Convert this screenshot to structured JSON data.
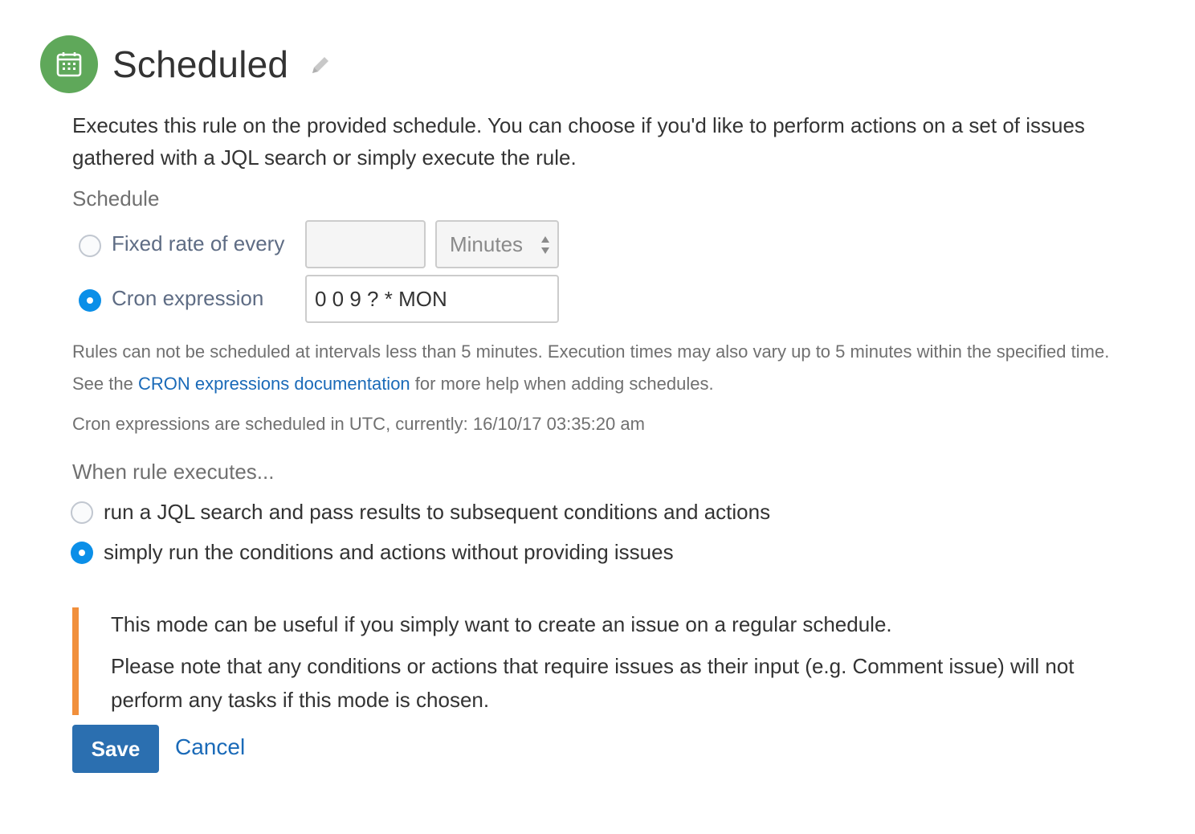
{
  "header": {
    "title": "Scheduled",
    "icon": "calendar-icon",
    "edit_icon": "pencil-icon",
    "accent_color": "#5fa85a"
  },
  "description": "Executes this rule on the provided schedule. You can choose if you'd like to perform actions on a set of issues gathered with a JQL search or simply execute the rule.",
  "schedule": {
    "label": "Schedule",
    "fixed_rate": {
      "label": "Fixed rate of every",
      "checked": false,
      "value": "",
      "unit": "Minutes"
    },
    "cron": {
      "label": "Cron expression",
      "checked": true,
      "value": "0 0 9 ? * MON"
    },
    "help_pre": "Rules can not be scheduled at intervals less than 5 minutes. Execution times may also vary up to 5 minutes within the specified time. See the ",
    "help_link": "CRON expressions documentation",
    "help_post": " for more help when adding schedules.",
    "utc_note": "Cron expressions are scheduled in UTC, currently: 16/10/17 03:35:20 am"
  },
  "execution": {
    "label": "When rule executes...",
    "options": [
      {
        "label": "run a JQL search and pass results to subsequent conditions and actions",
        "checked": false
      },
      {
        "label": "simply run the conditions and actions without providing issues",
        "checked": true
      }
    ]
  },
  "note": {
    "line1": "This mode can be useful if you simply want to create an issue on a regular schedule.",
    "line2": "Please note that any conditions or actions that require issues as their input (e.g. Comment issue) will not perform any tasks if this mode is chosen.",
    "accent_color": "#f18f3b"
  },
  "actions": {
    "save_label": "Save",
    "cancel_label": "Cancel"
  }
}
